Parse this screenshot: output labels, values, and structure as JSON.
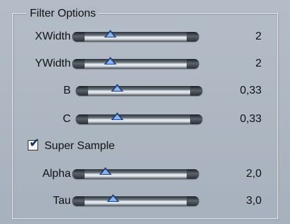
{
  "group": {
    "title": "Filter Options"
  },
  "sliders": [
    {
      "label": "XWidth",
      "value": "2",
      "level": 0.3
    },
    {
      "label": "YWidth",
      "value": "2",
      "level": 0.3
    },
    {
      "label": "B",
      "value": "0,33",
      "level": 0.33
    },
    {
      "label": "C",
      "value": "0,33",
      "level": 0.33
    },
    {
      "label": "Alpha",
      "value": "2,0",
      "level": 0.26
    },
    {
      "label": "Tau",
      "value": "3,0",
      "level": 0.32
    }
  ],
  "super_sample": {
    "label": "Super Sample",
    "checked": true,
    "mark": "✔"
  },
  "colors": {
    "thumb": "#1d3f86",
    "background": "#a9b3bf"
  }
}
